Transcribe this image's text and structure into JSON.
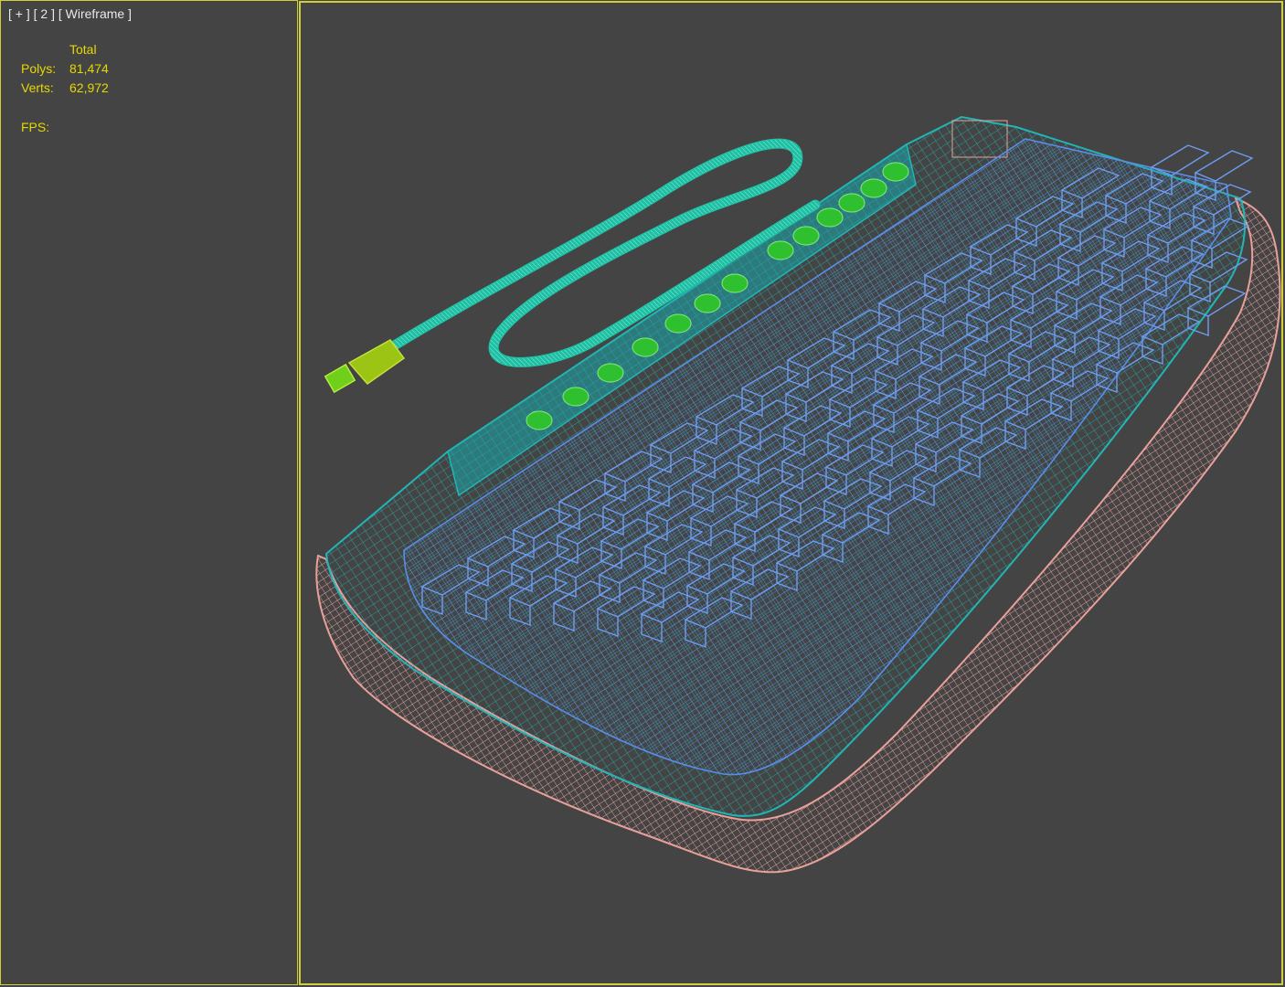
{
  "viewport": {
    "label": "[ + ] [ 2 ] [ Wireframe ]",
    "border_color": "#cfcf3c",
    "background": "#444444"
  },
  "stats": {
    "header": "Total",
    "polys_label": "Polys:",
    "polys_value": "81,474",
    "verts_label": "Verts:",
    "verts_value": "62,972",
    "fps_label": "FPS:"
  },
  "model": {
    "colors": {
      "base_shell": "#e8a09a",
      "frame": "#22b5b5",
      "keys": "#5a8de8",
      "cable": "#1fbfa3",
      "connector": "#9cc414",
      "leds": "#2fc02f"
    }
  }
}
